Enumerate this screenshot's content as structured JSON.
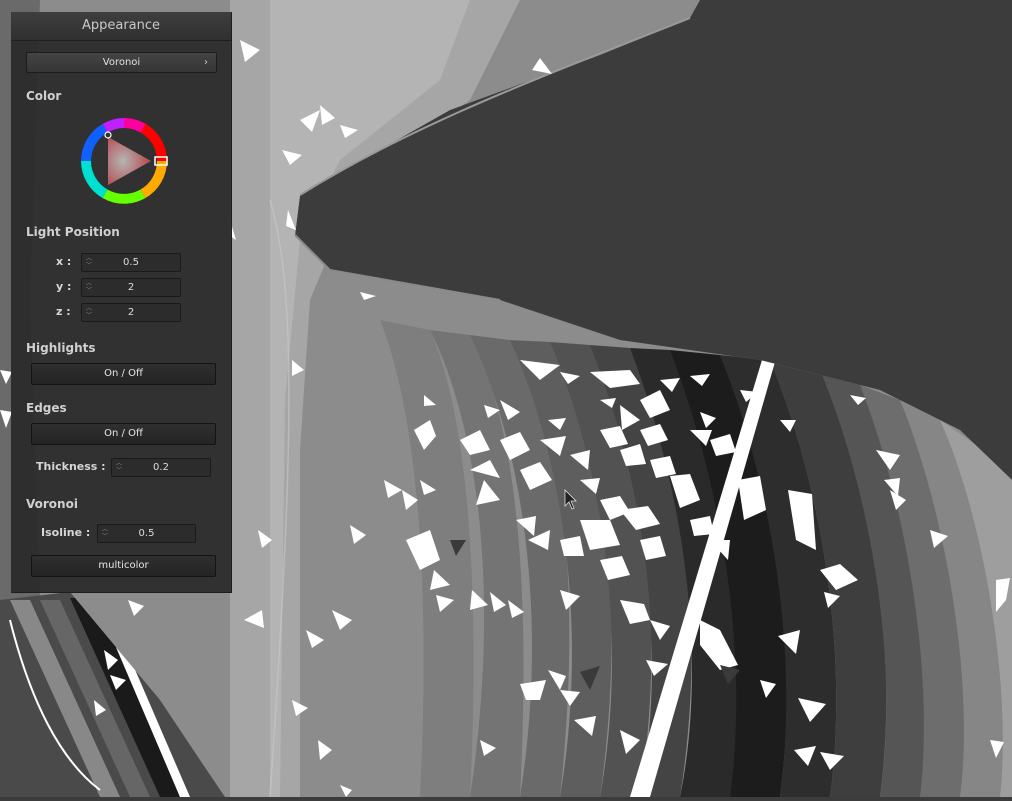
{
  "panel": {
    "title": "Appearance",
    "mode_dropdown": {
      "value": "Voronoi",
      "chevron": "›"
    },
    "color": {
      "label": "Color",
      "selected_hue": "#e8323c"
    },
    "light_position": {
      "label": "Light Position",
      "x": {
        "label": "x :",
        "value": "0.5"
      },
      "y": {
        "label": "y :",
        "value": "2"
      },
      "z": {
        "label": "z :",
        "value": "2"
      }
    },
    "highlights": {
      "label": "Highlights",
      "toggle_label": "On / Off"
    },
    "edges": {
      "label": "Edges",
      "toggle_label": "On / Off",
      "thickness": {
        "label": "Thickness :",
        "value": "0.2"
      }
    },
    "voronoi": {
      "label": "Voronoi",
      "isoline": {
        "label": "Isoline :",
        "value": "0.5"
      },
      "multicolor_label": "multicolor"
    }
  },
  "icons": {
    "cursor": "mouse-pointer-icon",
    "spinner": "spinner-arrows-icon",
    "chevron": "chevron-right-icon"
  }
}
